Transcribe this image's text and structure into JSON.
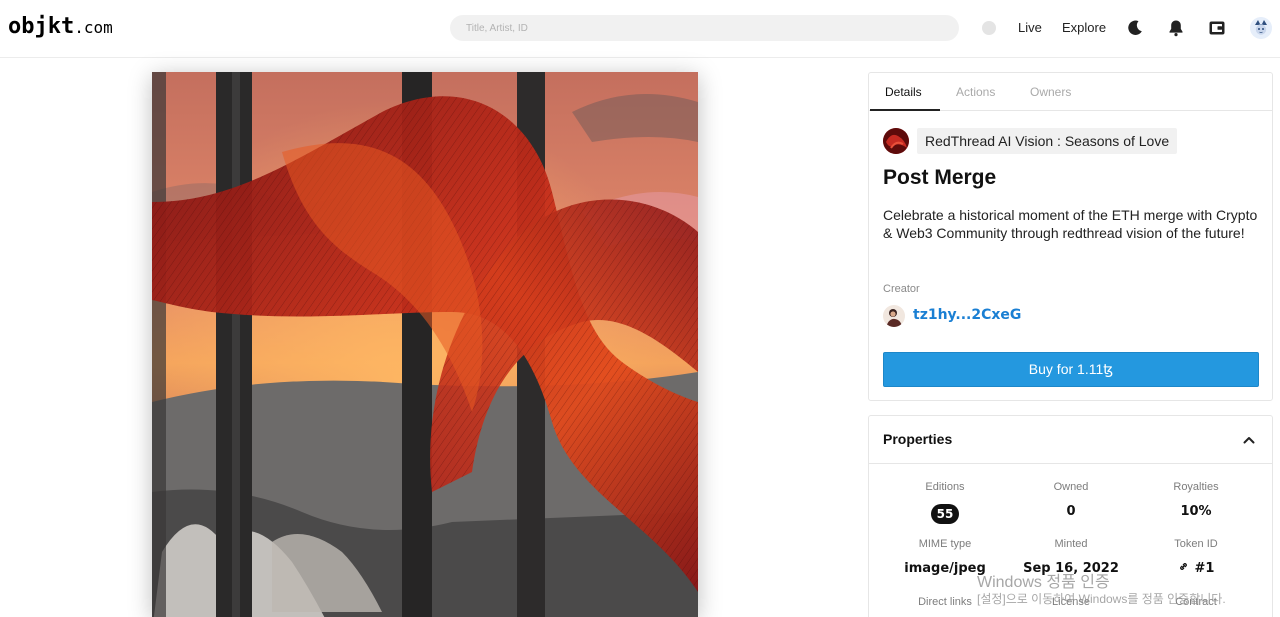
{
  "header": {
    "logo_main": "objkt",
    "logo_suffix": ".com",
    "search_placeholder": "Title, Artist, ID",
    "nav": {
      "live": "Live",
      "explore": "Explore"
    },
    "icons": [
      "moon-icon",
      "bell-icon",
      "wallet-icon",
      "user-avatar"
    ]
  },
  "artwork": {
    "palette": {
      "sky_top": "#d8856a",
      "sky_glow": "#f2a75f",
      "ribbon": "#a8201c",
      "ribbon_lit": "#e0421a",
      "hills": "#6d6b6a",
      "bars": "#2b2a2a"
    }
  },
  "details": {
    "tabs": [
      "Details",
      "Actions",
      "Owners"
    ],
    "active_tab": "Details",
    "collection": "RedThread AI Vision : Seasons of Love",
    "title": "Post Merge",
    "description": "Celebrate a historical moment of the ETH merge with Crypto & Web3 Community through redthread vision of the future!",
    "creator_label": "Creator",
    "creator": "tz1hy...2CxeG",
    "buy_label": "Buy for 1.11ꜩ",
    "accent_color": "#2498df"
  },
  "properties": {
    "title": "Properties",
    "editions_label": "Editions",
    "editions": "55",
    "owned_label": "Owned",
    "owned": "0",
    "royalties_label": "Royalties",
    "royalties": "10%",
    "mime_label": "MIME type",
    "mime": "image/jpeg",
    "minted_label": "Minted",
    "minted": "Sep 16, 2022",
    "token_label": "Token ID",
    "token": "#1",
    "direct_links_label": "Direct links",
    "license_label": "License",
    "contract_label": "Contract"
  },
  "watermark": {
    "line1": "Windows 정품 인증",
    "line2": "[설정]으로 이동하여 Windows를 정품 인증합니다."
  }
}
